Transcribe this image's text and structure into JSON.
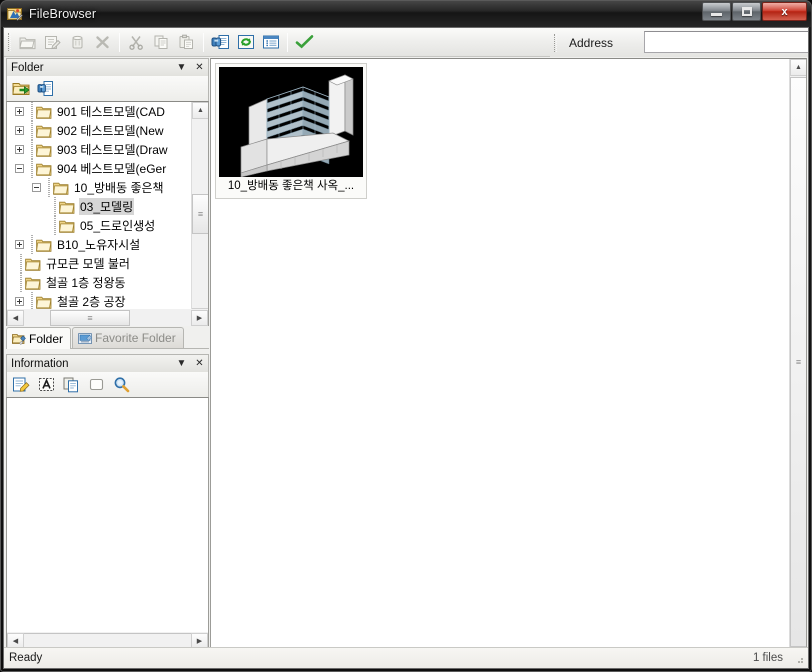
{
  "window": {
    "title": "FileBrowser",
    "app_icon": "filebrowser-app-icon",
    "controls": {
      "minimize": "minimize-button",
      "maximize": "maximize-button",
      "close_label": "x"
    }
  },
  "toolbar": {
    "buttons": [
      {
        "name": "open-folder-icon",
        "label": "Open",
        "enabled": false
      },
      {
        "name": "rename-edit-icon",
        "label": "Rename",
        "enabled": false
      },
      {
        "name": "delete-trash-icon",
        "label": "Delete",
        "enabled": false
      },
      {
        "name": "remove-x-icon",
        "label": "Remove",
        "enabled": false
      },
      {
        "name": "cut-scissors-icon",
        "label": "Cut",
        "enabled": false
      },
      {
        "name": "copy-icon",
        "label": "Copy",
        "enabled": false
      },
      {
        "name": "paste-icon",
        "label": "Paste",
        "enabled": false
      },
      {
        "name": "find-binoculars-icon",
        "label": "Find",
        "enabled": true
      },
      {
        "name": "refresh-icon",
        "label": "Refresh",
        "enabled": true
      },
      {
        "name": "details-view-icon",
        "label": "Details",
        "enabled": true
      },
      {
        "name": "confirm-check-icon",
        "label": "Apply",
        "enabled": true
      }
    ]
  },
  "address": {
    "label": "Address",
    "value": "",
    "placeholder": ""
  },
  "folder_panel": {
    "caption": "Folder",
    "caption_buttons": {
      "menu": "▼",
      "close": "✕"
    },
    "tools": [
      {
        "name": "goto-folder-icon",
        "label": "Go To Folder"
      },
      {
        "name": "find-in-document-icon",
        "label": "Find Document"
      }
    ],
    "tree": [
      {
        "label": "901 테스트모델(CAD",
        "indent": 1,
        "expander": "plus",
        "selected": false
      },
      {
        "label": "902 테스트모델(New",
        "indent": 1,
        "expander": "plus",
        "selected": false
      },
      {
        "label": "903 테스트모델(Draw",
        "indent": 1,
        "expander": "plus",
        "selected": false
      },
      {
        "label": "904 베스트모델(eGer",
        "indent": 1,
        "expander": "minus",
        "selected": false
      },
      {
        "label": "10_방배동 좋은책",
        "indent": 2,
        "expander": "minus",
        "selected": false
      },
      {
        "label": "03_모델링",
        "indent": 3,
        "expander": "none",
        "selected": true
      },
      {
        "label": "05_드로인생성",
        "indent": 3,
        "expander": "none",
        "selected": false
      },
      {
        "label": "B10_노유자시설",
        "indent": 1,
        "expander": "plus",
        "selected": false
      },
      {
        "label": "규모큰 모델 불러",
        "indent": 1,
        "expander": "none",
        "selected": false
      },
      {
        "label": "철골 1층 정왕동",
        "indent": 1,
        "expander": "none",
        "selected": false
      },
      {
        "label": "철골 2층 공장",
        "indent": 1,
        "expander": "plus",
        "selected": false
      }
    ],
    "tabs": [
      {
        "label": "Folder",
        "icon": "folder-tab-icon",
        "active": true
      },
      {
        "label": "Favorite Folder",
        "icon": "favorite-tab-icon",
        "active": false
      }
    ]
  },
  "information_panel": {
    "caption": "Information",
    "caption_buttons": {
      "menu": "▼",
      "close": "✕"
    },
    "tools": [
      {
        "name": "edit-note-icon",
        "label": "Edit"
      },
      {
        "name": "text-attribute-icon",
        "label": "Text"
      },
      {
        "name": "copy-info-icon",
        "label": "Copy"
      },
      {
        "name": "blank-page-icon",
        "label": "New"
      },
      {
        "name": "magnifier-icon",
        "label": "Zoom"
      }
    ],
    "body_text": ""
  },
  "content": {
    "items": [
      {
        "label": "10_방배동 좋은책 사옥_...",
        "thumbnail": "building-3d-model-thumbnail",
        "selected": false
      }
    ]
  },
  "statusbar": {
    "message": "Ready",
    "file_count": "1 files"
  },
  "colors": {
    "accent_close": "#c83020",
    "panel_bg": "#f0f0ee",
    "thumb_bg": "#000000",
    "selection": "#d6d6d6"
  },
  "scroll": {
    "up_arrow": "▲",
    "down_arrow": "▼",
    "left_arrow": "◀",
    "right_arrow": "▶",
    "thumb_grip": "≡"
  }
}
